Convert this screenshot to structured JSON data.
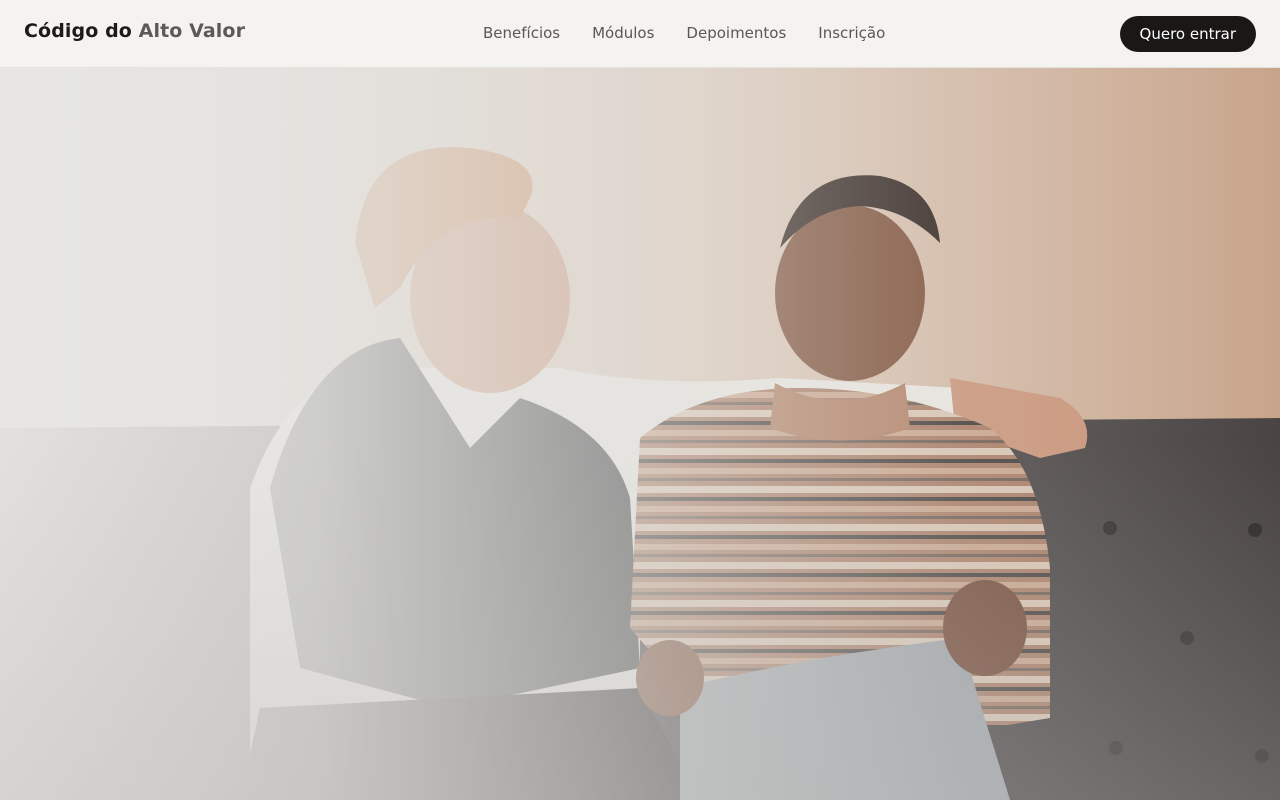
{
  "brand": {
    "text_main": "Código do",
    "text_accent": "Alto Valor"
  },
  "nav": {
    "links": [
      {
        "label": "Benefícios"
      },
      {
        "label": "Módulos"
      },
      {
        "label": "Depoimentos"
      },
      {
        "label": "Inscrição"
      }
    ]
  },
  "cta": {
    "label": "Quero entrar"
  },
  "colors": {
    "background": "#f4f3ef",
    "brand_text": "#1d1b1a",
    "brand_accent": "#5c5956",
    "nav_text": "#5a5754",
    "cta_background": "#1a1817",
    "cta_text": "#ffffff"
  },
  "hero": {
    "image": "couple-on-leather-sofa-photo"
  }
}
